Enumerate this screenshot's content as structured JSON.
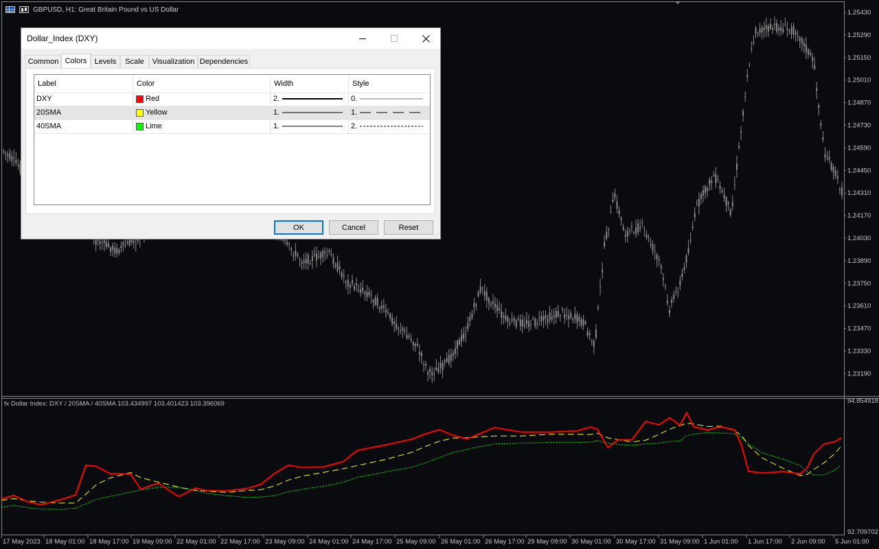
{
  "chart": {
    "title": "GBPUSD, H1:  Great Britain Pound vs US Dollar",
    "price_axis": [
      "1.25430",
      "1.25290",
      "1.25150",
      "1.25010",
      "1.24870",
      "1.24730",
      "1.24590",
      "1.24450",
      "1.24310",
      "1.24170",
      "1.24030",
      "1.23890",
      "1.23750",
      "1.23610",
      "1.23470",
      "1.23330",
      "1.23190"
    ],
    "time_axis": [
      "17 May 2023",
      "18 May 01:00",
      "18 May 17:00",
      "19 May 09:00",
      "22 May 01:00",
      "22 May 17:00",
      "23 May 09:00",
      "24 May 01:00",
      "24 May 17:00",
      "25 May 09:00",
      "26 May 01:00",
      "26 May 17:00",
      "29 May 09:00",
      "30 May 01:00",
      "30 May 17:00",
      "31 May 09:00",
      "1 Jun 01:00",
      "1 Jun 17:00",
      "2 Jun 09:00",
      "5 Jun 01:00"
    ],
    "colors": {
      "background": "#0a0b0f",
      "candles": "#8c8c8c",
      "axis_text": "#c8c8c8",
      "separator": "#8a8a8a"
    }
  },
  "indicator": {
    "label": "fx Dollar Index: DXY / 20SMA / 40SMA 103.434997 103.401423 103.396069",
    "axis_top": "94.854918",
    "axis_bottom": "92.709702",
    "series": [
      {
        "name": "DXY",
        "color": "#ff0000"
      },
      {
        "name": "20SMA",
        "color": "#ffff00"
      },
      {
        "name": "40SMA",
        "color": "#00ff00"
      }
    ]
  },
  "dialog": {
    "title": "Dollar_Index (DXY)",
    "tabs": [
      "Common",
      "Colors",
      "Levels",
      "Scale",
      "Visualization",
      "Dependencies"
    ],
    "active_tab": "Colors",
    "headers": {
      "label": "Label",
      "color": "Color",
      "width": "Width",
      "style": "Style"
    },
    "rows": [
      {
        "label": "DXY",
        "color_name": "Red",
        "color": "#ff0000",
        "width": "2.",
        "style": "0."
      },
      {
        "label": "20SMA",
        "color_name": "Yellow",
        "color": "#ffff00",
        "width": "1.",
        "style": "1."
      },
      {
        "label": "40SMA",
        "color_name": "Lime",
        "color": "#00ff00",
        "width": "1.",
        "style": "2."
      }
    ],
    "buttons": {
      "ok": "OK",
      "cancel": "Cancel",
      "reset": "Reset"
    }
  }
}
